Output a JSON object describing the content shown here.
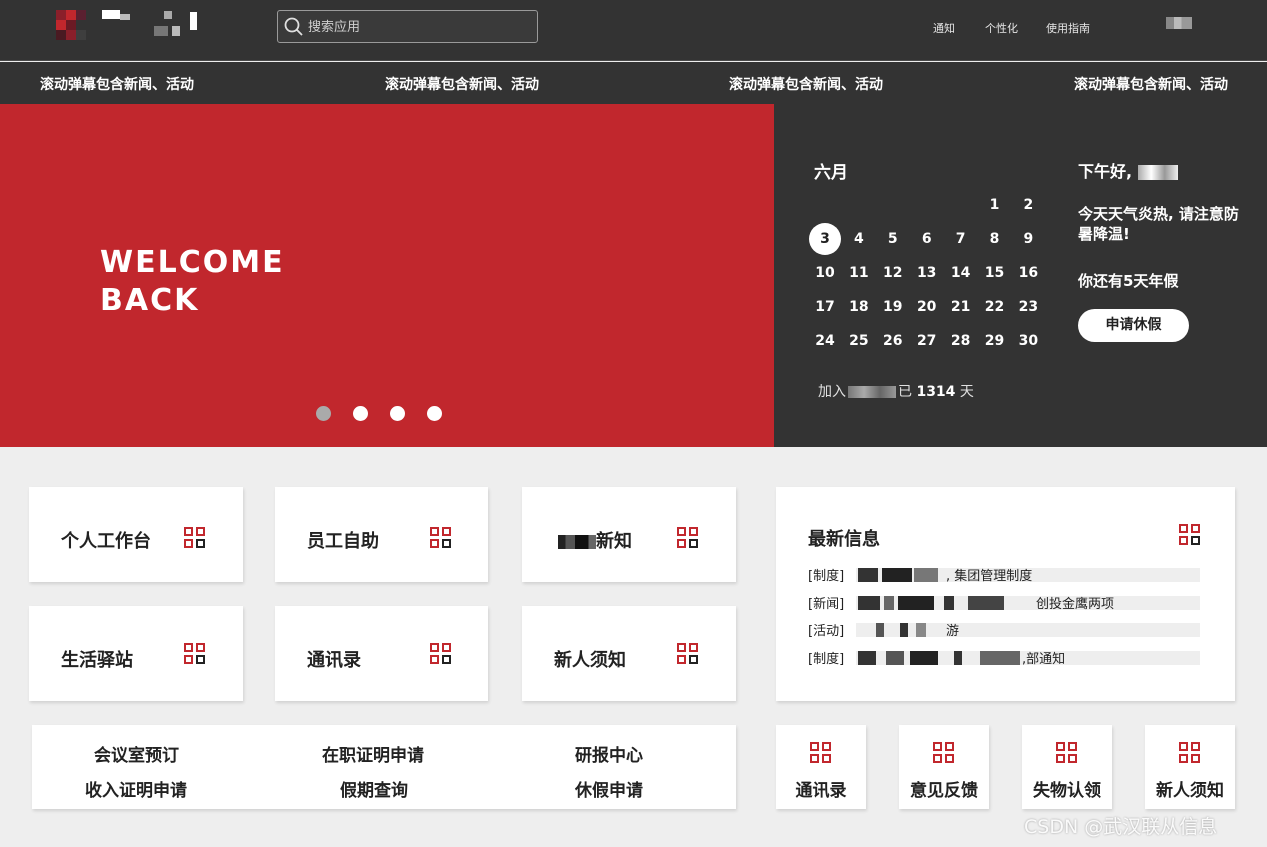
{
  "header": {
    "search_placeholder": "搜索应用",
    "nav": [
      "通知",
      "个性化",
      "使用指南"
    ]
  },
  "marquee": [
    "滚动弹幕包含新闻、活动",
    "滚动弹幕包含新闻、活动",
    "滚动弹幕包含新闻、活动",
    "滚动弹幕包含新闻、活动"
  ],
  "hero": {
    "welcome_line1": "WELCOME",
    "welcome_line2": "BACK",
    "slide_count": 4,
    "active_slide": 1
  },
  "calendar": {
    "month": "六月",
    "days": [
      "1",
      "2",
      "3",
      "4",
      "5",
      "6",
      "7",
      "8",
      "9",
      "10",
      "11",
      "12",
      "13",
      "14",
      "15",
      "16",
      "17",
      "18",
      "19",
      "20",
      "21",
      "22",
      "23",
      "24",
      "25",
      "26",
      "27",
      "28",
      "29",
      "30"
    ],
    "today": "3",
    "joined_prefix": "加入",
    "joined_mid": "已",
    "joined_days": "1314",
    "joined_suffix": "天"
  },
  "greeting": {
    "hello": "下午好,",
    "weather": "今天天气炎热, 请注意防暑降温!",
    "holiday": "你还有5天年假",
    "leave_button": "申请休假"
  },
  "cards": {
    "workbench": "个人工作台",
    "self_service": "员工自助",
    "notice_suffix": "新知",
    "life": "生活驿站",
    "contacts": "通讯录",
    "newcomer": "新人须知"
  },
  "news": {
    "title": "最新信息",
    "items": [
      {
        "tag": "[制度]",
        "text": ", 集团管理制度"
      },
      {
        "tag": "[新闻]",
        "text": "创投金鹰两项"
      },
      {
        "tag": "[活动]",
        "text": "游"
      },
      {
        "tag": "[制度]",
        "text": ",部通知"
      }
    ]
  },
  "quick_links": [
    "会议室预订",
    "在职证明申请",
    "研报中心",
    "收入证明申请",
    "假期查询",
    "休假申请"
  ],
  "mini_apps": [
    "通讯录",
    "意见反馈",
    "失物认领",
    "新人须知"
  ],
  "watermark": "CSDN @武汉联从信息",
  "colors": {
    "accent": "#c1272d",
    "dark": "#333333",
    "background": "#eeeeee"
  }
}
